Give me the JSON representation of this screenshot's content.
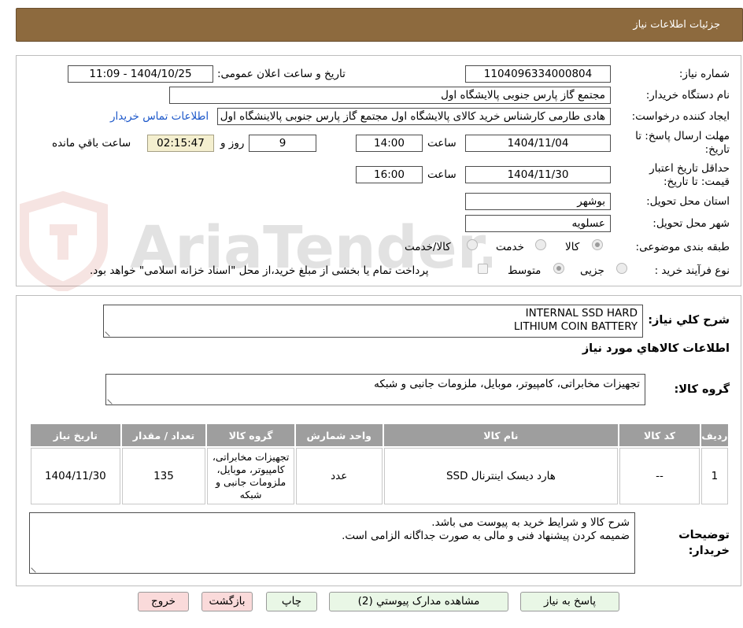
{
  "header": {
    "title": "جزئیات اطلاعات نیاز"
  },
  "form": {
    "need_number_label": "شماره نیاز:",
    "need_number": "1104096334000804",
    "announce_label": "تاریخ و ساعت اعلان عمومی:",
    "announce_value": "1404/10/25 - 11:09",
    "buyer_org_label": "نام دستگاه خریدار:",
    "buyer_org": "مجتمع گاز پارس جنوبی  پالایشگاه اول",
    "requester_label": "ایجاد کننده درخواست:",
    "requester": "هادی طارمی کارشناس خرید کالای پالایشگاه اول مجتمع گاز پارس جنوبی  پالاینشگاه اول",
    "contact_link": "اطلاعات تماس خریدار",
    "reply_deadline_label": "مهلت ارسال پاسخ: تا تاریخ:",
    "reply_date": "1404/11/04",
    "time_label": "ساعت",
    "reply_time": "14:00",
    "days_value": "9",
    "days_label": "روز و",
    "remaining_time": "02:15:47",
    "remaining_label": "ساعت باقي مانده",
    "price_validity_label": "حداقل تاریخ اعتبار قیمت: تا تاریخ:",
    "validity_date": "1404/11/30",
    "validity_time": "16:00",
    "province_label": "استان محل تحویل:",
    "province": "بوشهر",
    "city_label": "شهر محل تحویل:",
    "city": "عسلویه",
    "category_label": "طبقه بندی موضوعی:",
    "category_options": [
      "کالا",
      "خدمت",
      "کالا/خدمت"
    ],
    "process_label": "نوع فرآیند خرید :",
    "process_options": [
      "جزیی",
      "متوسط"
    ],
    "payment_note": "پرداخت تمام یا بخشی از مبلغ خرید،از محل \"اسناد خزانه اسلامی\" خواهد بود."
  },
  "summary": {
    "label": "شرح کلي نياز:",
    "lines": [
      "INTERNAL SSD HARD",
      "LITHIUM COIN BATTERY"
    ],
    "goods_info_title": "اطلاعات کالاهاي مورد نياز",
    "group_label": "گروه کالا:",
    "group_value": "تجهیزات مخابراتی، کامپیوتر، موبایل، ملزومات جانبی و شبکه"
  },
  "table": {
    "headers": [
      "ردیف",
      "کد کالا",
      "نام کالا",
      "واحد شمارش",
      "گروه کالا",
      "تعداد / مقدار",
      "تاریخ نیاز"
    ],
    "rows": [
      [
        "1",
        "--",
        "هارد دیسک اینترنال SSD",
        "عدد",
        "تجهیزات مخابراتی، کامپیوتر، موبایل، ملزومات جانبی و شبکه",
        "135",
        "1404/11/30"
      ]
    ]
  },
  "notes": {
    "label": "توضیحات خریدار:",
    "lines": [
      "شرح کالا و شرایط خرید به پیوست می باشد.",
      "ضمیمه کردن پیشنهاد فنی و مالی به صورت جداگانه الزامی است."
    ]
  },
  "buttons": {
    "reply": "پاسخ به نیاز",
    "attachments": "مشاهده مدارک پیوستي (2)",
    "print": "چاپ",
    "back": "بازگشت",
    "exit": "خروج"
  },
  "watermark": {
    "text": "AriaTender.neT"
  },
  "colors": {
    "header_bg": "#8d6a3e",
    "table_header_bg": "#9e9e9e",
    "button_green": "#e9f7e6",
    "button_pink": "#fadada",
    "link": "#1a56c9"
  }
}
